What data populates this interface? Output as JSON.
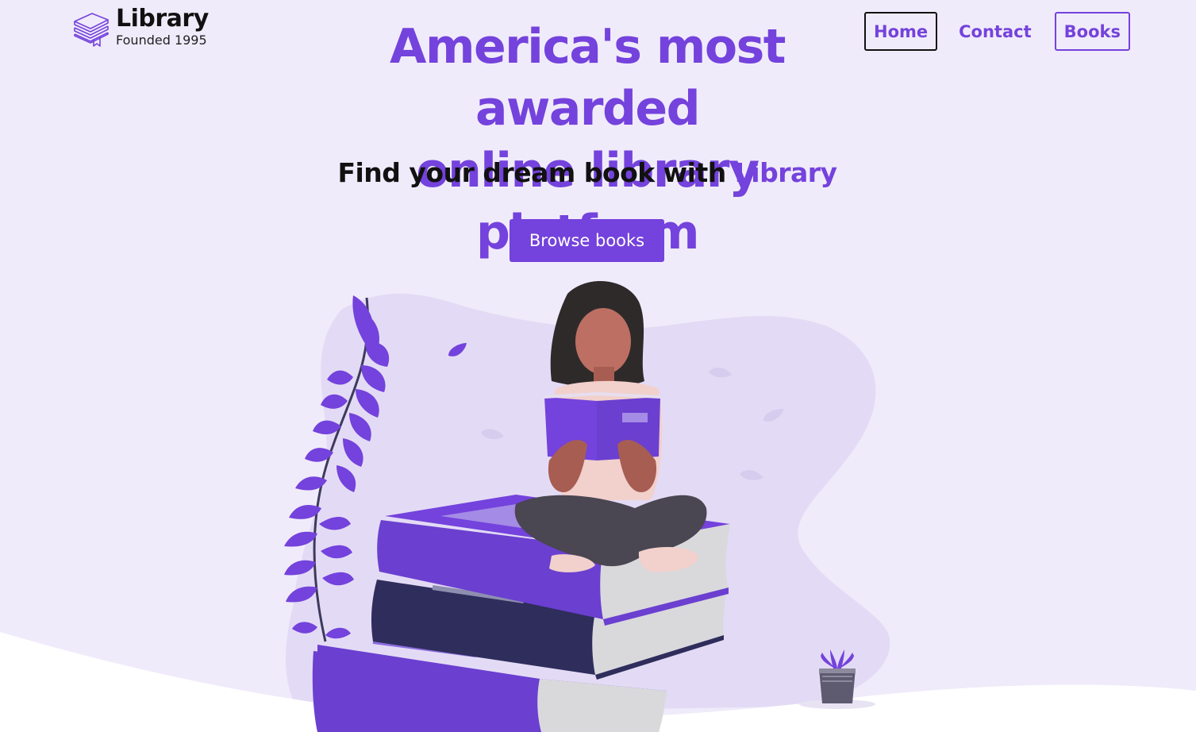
{
  "logo": {
    "title": "Library",
    "subtitle": "Founded 1995"
  },
  "nav": {
    "home": "Home",
    "contact": "Contact",
    "books": "Books"
  },
  "hero": {
    "headline_line1": "America's most awarded",
    "headline_line2": "online library platform",
    "subheadline_prefix": "Find your dream book with ",
    "subheadline_accent": "Library",
    "cta_label": "Browse books"
  },
  "colors": {
    "accent": "#7442dc",
    "background": "#f0ebfa",
    "text": "#111111"
  },
  "icons": {
    "logo": "books-stack-icon"
  }
}
